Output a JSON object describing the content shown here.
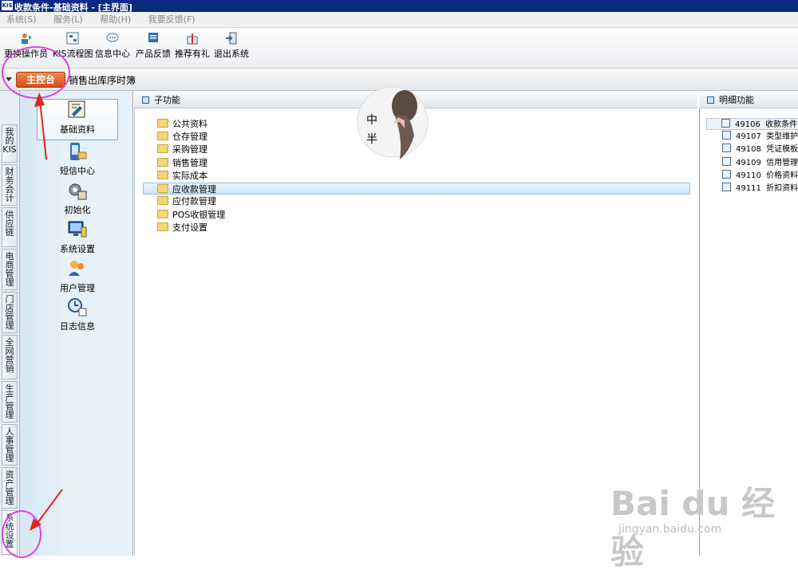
{
  "window": {
    "logo": "KIS",
    "title": "收款条件-基础资料 - [主界面]"
  },
  "menu": [
    "系统(S)",
    "服务(L)",
    "帮助(H)",
    "我要反馈(F)"
  ],
  "toolbar": [
    {
      "label": "更换操作员",
      "icon": "user-switch-icon"
    },
    {
      "label": "KIS流程图",
      "icon": "flowchart-icon"
    },
    {
      "label": "信息中心",
      "icon": "message-center-icon"
    },
    {
      "label": "产品反馈",
      "icon": "feedback-icon"
    },
    {
      "label": "推荐有礼",
      "icon": "gift-icon"
    },
    {
      "label": "退出系统",
      "icon": "exit-icon"
    }
  ],
  "tabs": {
    "main": "主控台",
    "second": "销售出库序时簿"
  },
  "leftnav": [
    "我的KIS",
    "财务会计",
    "供应链",
    "电商管理",
    "门店管理",
    "全网营销",
    "生产管理",
    "人事管理",
    "资产管理",
    "系统设置"
  ],
  "iconpanel": [
    {
      "label": "基础资料",
      "icon": "base-data-icon"
    },
    {
      "label": "短信中心",
      "icon": "sms-center-icon"
    },
    {
      "label": "初始化",
      "icon": "initialize-icon"
    },
    {
      "label": "系统设置",
      "icon": "system-settings-icon"
    },
    {
      "label": "用户管理",
      "icon": "user-management-icon"
    },
    {
      "label": "日志信息",
      "icon": "log-info-icon"
    }
  ],
  "subfunc": {
    "title": "子功能",
    "items": [
      "公共资料",
      "仓存管理",
      "采购管理",
      "销售管理",
      "实际成本",
      "应收款管理",
      "应付款管理",
      "POS收银管理",
      "支付设置"
    ],
    "selected": "应收款管理"
  },
  "detail": {
    "title": "明细功能",
    "items": [
      {
        "code": "49106",
        "name": "收款条件"
      },
      {
        "code": "49107",
        "name": "类型维护"
      },
      {
        "code": "49108",
        "name": "凭证模板"
      },
      {
        "code": "49109",
        "name": "信用管理"
      },
      {
        "code": "49110",
        "name": "价格资料"
      },
      {
        "code": "49111",
        "name": "折扣资料"
      }
    ]
  },
  "overlay": {
    "avatar_text_1": "中",
    "avatar_text_2": "半",
    "watermark": "Bai du 经验",
    "watermark_url": "jingyan.baidu.com"
  },
  "colors": {
    "titlebar": "#0b2b6e",
    "tab_main": "#d4501b",
    "annotation": "#e040e8",
    "panel": "#e6f1f8"
  }
}
